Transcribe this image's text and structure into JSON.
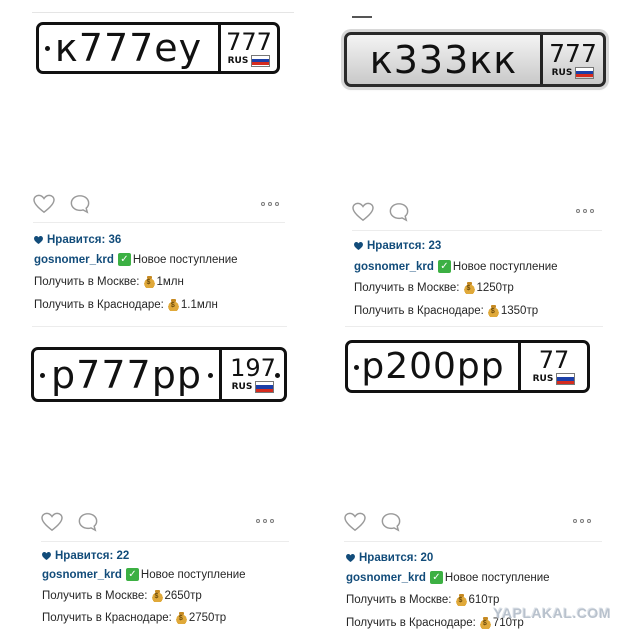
{
  "posts": [
    {
      "plate": {
        "chars": "к777еу",
        "region": "777",
        "rus": "RUS"
      },
      "likes": "Нравится: 36",
      "username": "gosnomer_krd",
      "caption": "Новое поступление",
      "moscow_label": "Получить в Москве:",
      "moscow_price": "1млн",
      "krasnodar_label": "Получить в Краснодаре:",
      "krasnodar_price": "1.1млн"
    },
    {
      "plate": {
        "chars": "к333кк",
        "region": "777",
        "rus": "RUS"
      },
      "likes": "Нравится: 23",
      "username": "gosnomer_krd",
      "caption": "Новое поступление",
      "moscow_label": "Получить в Москве:",
      "moscow_price": "1250тр",
      "krasnodar_label": "Получить в Краснодаре:",
      "krasnodar_price": "1350тр"
    },
    {
      "plate": {
        "chars": "р777рр",
        "region": "197",
        "rus": "RUS"
      },
      "likes": "Нравится: 22",
      "username": "gosnomer_krd",
      "caption": "Новое поступление",
      "moscow_label": "Получить в Москве:",
      "moscow_price": "2650тр",
      "krasnodar_label": "Получить в Краснодаре:",
      "krasnodar_price": "2750тр"
    },
    {
      "plate": {
        "chars": "р200рр",
        "region": "77",
        "rus": "RUS"
      },
      "likes": "Нравится: 20",
      "username": "gosnomer_krd",
      "caption": "Новое поступление",
      "moscow_label": "Получить в Москве:",
      "moscow_price": "610тр",
      "krasnodar_label": "Получить в Краснодаре:",
      "krasnodar_price": "710тр"
    }
  ],
  "watermark": "YAPLAKAL.COM",
  "colors": {
    "username": "#124c7a",
    "check": "#3cb043",
    "text": "#262626"
  }
}
